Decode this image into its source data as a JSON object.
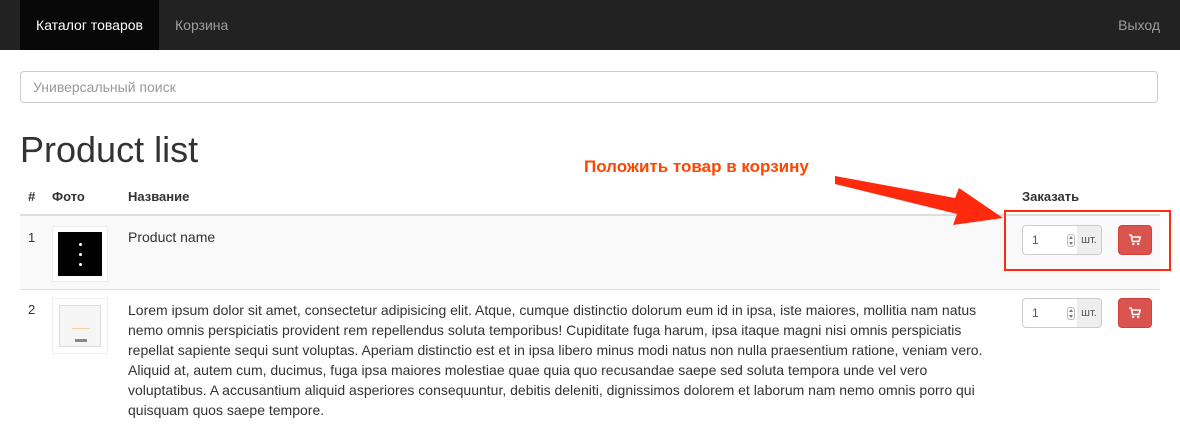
{
  "nav": {
    "catalog_label": "Каталог товаров",
    "cart_label": "Корзина",
    "logout_label": "Выход"
  },
  "search": {
    "placeholder": "Универсальный поиск",
    "value": ""
  },
  "page_title": "Product list",
  "table": {
    "headers": {
      "num": "#",
      "photo": "Фото",
      "name": "Название",
      "order": "Заказать"
    },
    "rows": [
      {
        "num": "1",
        "name": "Product name",
        "quantity": "1",
        "unit": "шт."
      },
      {
        "num": "2",
        "name": "Lorem ipsum dolor sit amet, consectetur adipisicing elit. Atque, cumque distinctio dolorum eum id in ipsa, iste maiores, mollitia nam natus nemo omnis perspiciatis provident rem repellendus soluta temporibus! Cupiditate fuga harum, ipsa itaque magni nisi omnis perspiciatis repellat sapiente sequi sunt voluptas. Aperiam distinctio est et in ipsa libero minus modi natus non nulla praesentium ratione, veniam vero. Aliquid at, autem cum, ducimus, fuga ipsa maiores molestiae quae quia quo recusandae saepe sed soluta tempora unde vel vero voluptatibus. A accusantium aliquid asperiores consequuntur, debitis deleniti, dignissimos dolorem et laborum nam nemo omnis porro qui quisquam quos saepe tempore.",
        "quantity": "1",
        "unit": "шт."
      }
    ]
  },
  "annotation": {
    "text": "Положить товар в корзину"
  },
  "icons": {
    "cart_button": "shopping-cart-icon",
    "arrow": "arrow-right-icon"
  },
  "colors": {
    "navbar": "#222222",
    "nav_active": "#080808",
    "danger_button": "#d9534f",
    "annotation": "#ff4500",
    "highlight_box": "#ff2a0e"
  }
}
